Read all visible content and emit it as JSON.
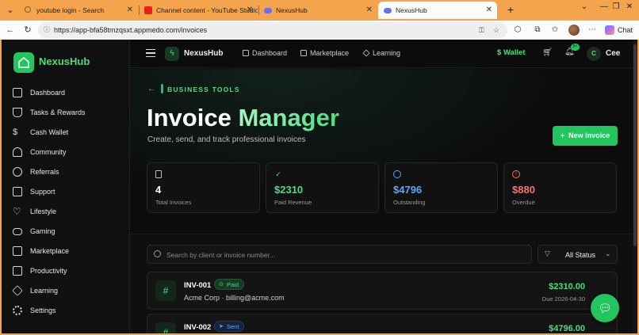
{
  "browser": {
    "tabs": [
      {
        "title": "youtube login - Search",
        "icon": "search-icon",
        "active": false
      },
      {
        "title": "Channel content - YouTube Studio",
        "icon": "youtube-icon",
        "active": false
      },
      {
        "title": "NexusHub",
        "icon": "nexushub-cloud-icon",
        "active": false
      },
      {
        "title": "NexusHub",
        "icon": "nexushub-cloud-icon",
        "active": true
      }
    ],
    "url": "https://app-bfa58tmzqsxt.appmedo.com/invoices",
    "copilot_label": "Chat"
  },
  "sidebar": {
    "brand": "NexusHub",
    "items": [
      {
        "label": "Dashboard",
        "icon": "dashboard-icon"
      },
      {
        "label": "Tasks & Rewards",
        "icon": "trophy-icon"
      },
      {
        "label": "Cash Wallet",
        "icon": "dollar-icon"
      },
      {
        "label": "Community",
        "icon": "users-icon"
      },
      {
        "label": "Referrals",
        "icon": "share-icon"
      },
      {
        "label": "Support",
        "icon": "message-icon"
      },
      {
        "label": "Lifestyle",
        "icon": "heart-icon"
      },
      {
        "label": "Gaming",
        "icon": "gamepad-icon"
      },
      {
        "label": "Marketplace",
        "icon": "shopping-bag-icon"
      },
      {
        "label": "Productivity",
        "icon": "book-icon"
      },
      {
        "label": "Learning",
        "icon": "graduation-cap-icon"
      },
      {
        "label": "Settings",
        "icon": "gear-icon"
      }
    ]
  },
  "topbar": {
    "brand": "NexusHub",
    "nav": [
      "Dashboard",
      "Marketplace",
      "Learning"
    ],
    "wallet": "Wallet",
    "notification_badge": "9+",
    "user_initial": "C",
    "user_name": "Cee"
  },
  "page": {
    "section": "BUSINESS TOOLS",
    "title_part1": "Invoice ",
    "title_part2": "Manager",
    "subtitle": "Create, send, and track professional invoices",
    "new_button": "New Invoice",
    "colors": {
      "accent": "#22c55e",
      "paid": "#4ade80",
      "outstanding": "#60a5fa",
      "overdue": "#f87171"
    }
  },
  "stats": [
    {
      "value": "4",
      "label": "Total Invoices",
      "icon": "document-icon",
      "color": "#ffffff"
    },
    {
      "value": "$2310",
      "label": "Paid Revenue",
      "icon": "check-circle-icon",
      "color": "#4ade80"
    },
    {
      "value": "$4796",
      "label": "Outstanding",
      "icon": "clock-icon",
      "color": "#60a5fa"
    },
    {
      "value": "$880",
      "label": "Overdue",
      "icon": "alert-circle-icon",
      "color": "#f87171"
    }
  ],
  "search": {
    "placeholder": "Search by client or invoice number..."
  },
  "filter": {
    "value": "All Status"
  },
  "invoices": [
    {
      "number": "INV-001",
      "status": "Paid",
      "client": "Acme Corp · billing@acme.com",
      "amount": "$2310.00",
      "due": "Due 2026-04-30"
    },
    {
      "number": "INV-002",
      "status": "Sent",
      "client": "",
      "amount": "$4796.00",
      "due": ""
    }
  ]
}
